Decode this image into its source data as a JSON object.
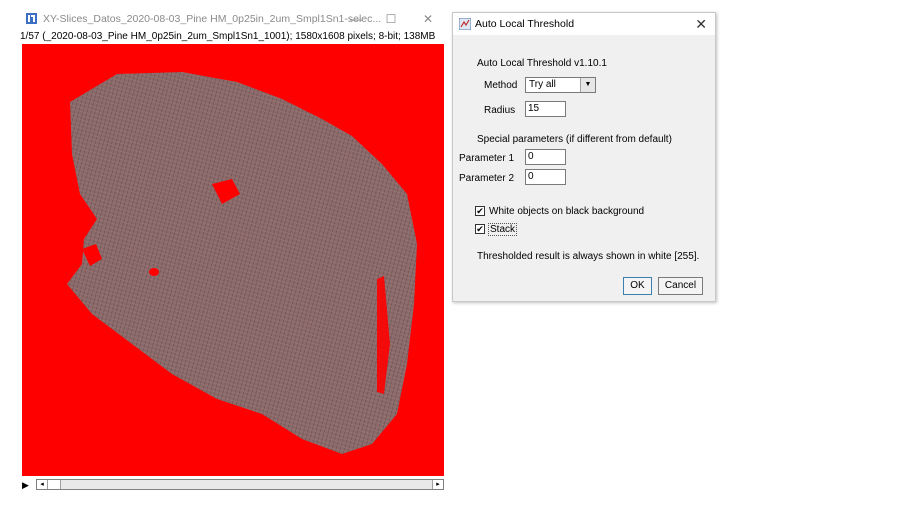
{
  "image_window": {
    "title": "XY-Slices_Datos_2020-08-03_Pine HM_0p25in_2um_Smpl1Sn1-selec...",
    "info": "1/57 (_2020-08-03_Pine HM_0p25in_2um_Smpl1Sn1_1001); 1580x1608 pixels; 8-bit; 138MB",
    "minimize": "—",
    "maximize": "☐",
    "close": "✕",
    "play_icon": "play-icon",
    "colors": {
      "threshold_red": "#ff0000",
      "sample_gray": "#8a6a6a"
    }
  },
  "dialog": {
    "title": "Auto Local Threshold",
    "close": "✕",
    "header": "Auto Local Threshold v1.10.1",
    "method_label": "Method",
    "method_value": "Try all",
    "radius_label": "Radius",
    "radius_value": "15",
    "special_params": "Special parameters (if different from default)",
    "param1_label": "Parameter 1",
    "param1_value": "0",
    "param2_label": "Parameter 2",
    "param2_value": "0",
    "white_objects_label": "White objects on black background",
    "white_objects_checked": true,
    "stack_label": "Stack",
    "stack_checked": true,
    "note": "Thresholded result is always shown in white [255].",
    "ok_label": "OK",
    "cancel_label": "Cancel"
  }
}
